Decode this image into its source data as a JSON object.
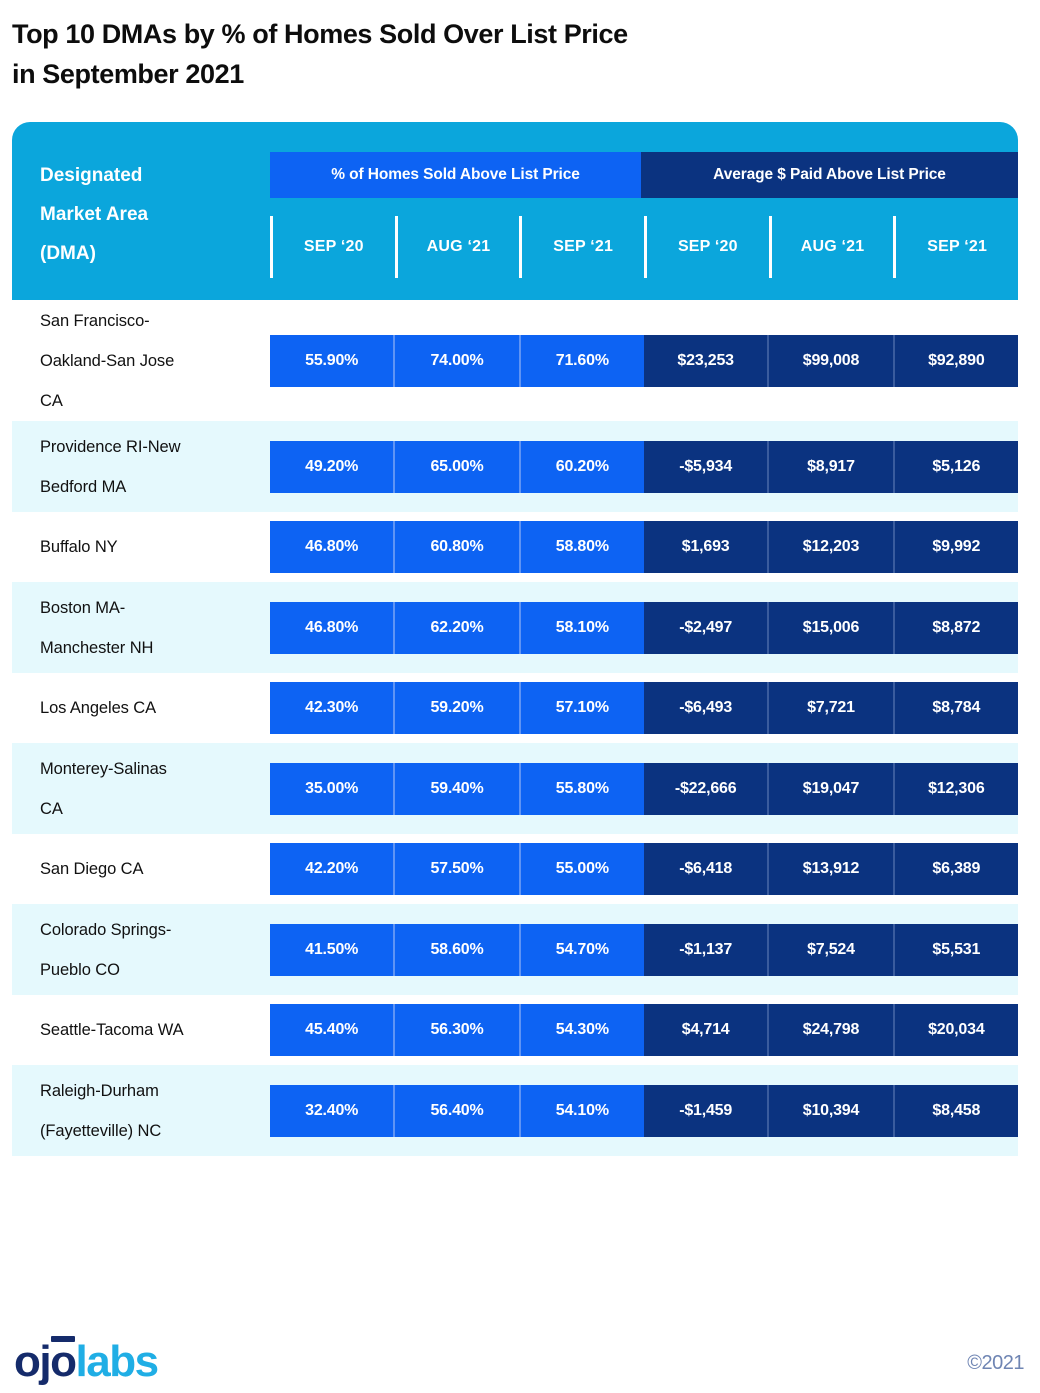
{
  "title": {
    "line1": "Top 10 DMAs by % of Homes Sold Over List Price",
    "line2": "in September 2021"
  },
  "table": {
    "row_header_label_line1": "Designated",
    "row_header_label_line2": "Market Area",
    "row_header_label_line3": "(DMA)",
    "groups": [
      {
        "label": "% of Homes Sold Above List Price",
        "color": "#0D63F3"
      },
      {
        "label": "Average $ Paid Above List Price",
        "color": "#0B3380"
      }
    ],
    "columns": [
      "SEP ‘20",
      "AUG ‘21",
      "SEP ‘21",
      "SEP ‘20",
      "AUG ‘21",
      "SEP ‘21"
    ],
    "rows": [
      {
        "dma_line1": "San Francisco-",
        "dma_line2": "Oakland-San Jose",
        "dma_line3": "CA",
        "pct_sep20": "55.90%",
        "pct_aug21": "74.00%",
        "pct_sep21": "71.60%",
        "avg_sep20": "$23,253",
        "avg_aug21": "$99,008",
        "avg_sep21": "$92,890"
      },
      {
        "dma_line1": "Providence RI-New",
        "dma_line2": "Bedford MA",
        "dma_line3": "",
        "pct_sep20": "49.20%",
        "pct_aug21": "65.00%",
        "pct_sep21": "60.20%",
        "avg_sep20": "-$5,934",
        "avg_aug21": "$8,917",
        "avg_sep21": "$5,126"
      },
      {
        "dma_line1": "Buffalo NY",
        "dma_line2": "",
        "dma_line3": "",
        "pct_sep20": "46.80%",
        "pct_aug21": "60.80%",
        "pct_sep21": "58.80%",
        "avg_sep20": "$1,693",
        "avg_aug21": "$12,203",
        "avg_sep21": "$9,992"
      },
      {
        "dma_line1": "Boston MA-",
        "dma_line2": "Manchester NH",
        "dma_line3": "",
        "pct_sep20": "46.80%",
        "pct_aug21": "62.20%",
        "pct_sep21": "58.10%",
        "avg_sep20": "-$2,497",
        "avg_aug21": "$15,006",
        "avg_sep21": "$8,872"
      },
      {
        "dma_line1": "Los Angeles CA",
        "dma_line2": "",
        "dma_line3": "",
        "pct_sep20": "42.30%",
        "pct_aug21": "59.20%",
        "pct_sep21": "57.10%",
        "avg_sep20": "-$6,493",
        "avg_aug21": "$7,721",
        "avg_sep21": "$8,784"
      },
      {
        "dma_line1": "Monterey-Salinas",
        "dma_line2": "CA",
        "dma_line3": "",
        "pct_sep20": "35.00%",
        "pct_aug21": "59.40%",
        "pct_sep21": "55.80%",
        "avg_sep20": "-$22,666",
        "avg_aug21": "$19,047",
        "avg_sep21": "$12,306"
      },
      {
        "dma_line1": "San Diego CA",
        "dma_line2": "",
        "dma_line3": "",
        "pct_sep20": "42.20%",
        "pct_aug21": "57.50%",
        "pct_sep21": "55.00%",
        "avg_sep20": "-$6,418",
        "avg_aug21": "$13,912",
        "avg_sep21": "$6,389"
      },
      {
        "dma_line1": "Colorado Springs-",
        "dma_line2": "Pueblo CO",
        "dma_line3": "",
        "pct_sep20": "41.50%",
        "pct_aug21": "58.60%",
        "pct_sep21": "54.70%",
        "avg_sep20": "-$1,137",
        "avg_aug21": "$7,524",
        "avg_sep21": "$5,531"
      },
      {
        "dma_line1": "Seattle-Tacoma WA",
        "dma_line2": "",
        "dma_line3": "",
        "pct_sep20": "45.40%",
        "pct_aug21": "56.30%",
        "pct_sep21": "54.30%",
        "avg_sep20": "$4,714",
        "avg_aug21": "$24,798",
        "avg_sep21": "$20,034"
      },
      {
        "dma_line1": "Raleigh-Durham",
        "dma_line2": "(Fayetteville) NC",
        "dma_line3": "",
        "pct_sep20": "32.40%",
        "pct_aug21": "56.40%",
        "pct_sep21": "54.10%",
        "avg_sep20": "-$1,459",
        "avg_aug21": "$10,394",
        "avg_sep21": "$8,458"
      }
    ]
  },
  "footer": {
    "logo_part1": "ojo",
    "logo_part2": "labs",
    "logo_o1": "o",
    "logo_j": "j",
    "logo_o2": "o",
    "copyright": "©2021"
  },
  "chart_data": {
    "type": "table",
    "title": "Top 10 DMAs by % of Homes Sold Over List Price in September 2021",
    "categories": [
      "San Francisco-Oakland-San Jose CA",
      "Providence RI-New Bedford MA",
      "Buffalo NY",
      "Boston MA-Manchester NH",
      "Los Angeles CA",
      "Monterey-Salinas CA",
      "San Diego CA",
      "Colorado Springs-Pueblo CO",
      "Seattle-Tacoma WA",
      "Raleigh-Durham (Fayetteville) NC"
    ],
    "series": [
      {
        "name": "% of Homes Sold Above List Price — SEP ‘20",
        "values": [
          55.9,
          49.2,
          46.8,
          46.8,
          42.3,
          35.0,
          42.2,
          41.5,
          45.4,
          32.4
        ]
      },
      {
        "name": "% of Homes Sold Above List Price — AUG ‘21",
        "values": [
          74.0,
          65.0,
          60.8,
          62.2,
          59.2,
          59.4,
          57.5,
          58.6,
          56.3,
          56.4
        ]
      },
      {
        "name": "% of Homes Sold Above List Price — SEP ‘21",
        "values": [
          71.6,
          60.2,
          58.8,
          58.1,
          57.1,
          55.8,
          55.0,
          54.7,
          54.3,
          54.1
        ]
      },
      {
        "name": "Average $ Paid Above List Price — SEP ‘20",
        "values": [
          23253,
          -5934,
          1693,
          -2497,
          -6493,
          -22666,
          -6418,
          -1137,
          4714,
          -1459
        ]
      },
      {
        "name": "Average $ Paid Above List Price — AUG ‘21",
        "values": [
          99008,
          8917,
          12203,
          15006,
          7721,
          19047,
          13912,
          7524,
          24798,
          10394
        ]
      },
      {
        "name": "Average $ Paid Above List Price — SEP ‘21",
        "values": [
          92890,
          5126,
          9992,
          8872,
          8784,
          12306,
          6389,
          5531,
          20034,
          8458
        ]
      }
    ],
    "xlabel": "Designated Market Area (DMA)",
    "ylabel": "",
    "legend": [
      "% of Homes Sold Above List Price",
      "Average $ Paid Above List Price"
    ]
  }
}
